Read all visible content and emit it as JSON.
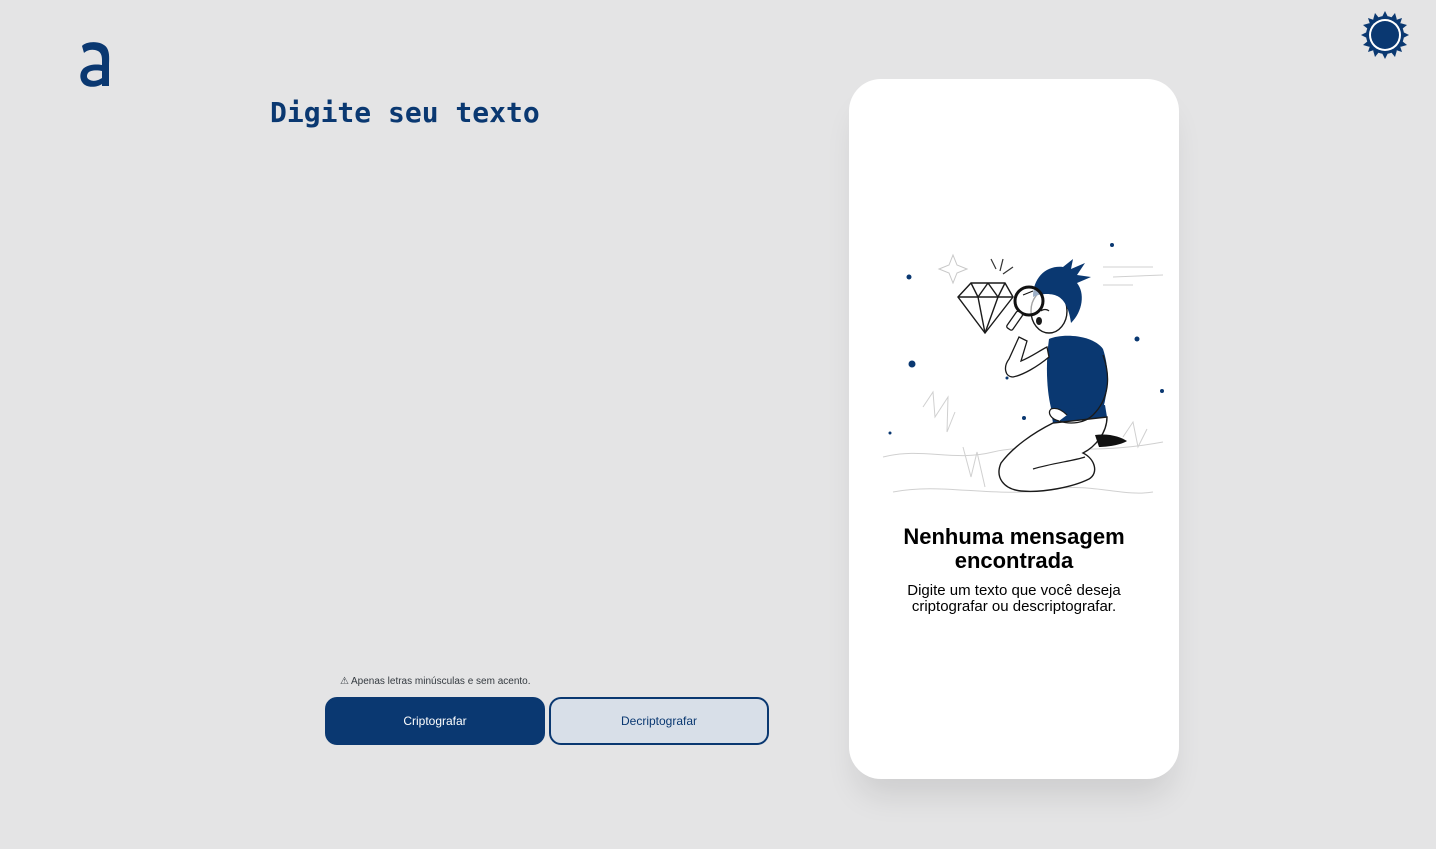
{
  "brand": {
    "logo_icon": "alura-logo-icon",
    "color": "#0a3871"
  },
  "theme_toggle": {
    "icon": "sun-icon"
  },
  "input": {
    "placeholder": "Digite seu texto",
    "value": ""
  },
  "hint": {
    "icon": "warning-icon",
    "symbol": "⚠",
    "text": "Apenas letras minúsculas e sem acento."
  },
  "actions": {
    "encrypt_label": "Criptografar",
    "decrypt_label": "Decriptografar"
  },
  "output": {
    "illustration": "person-with-magnifier-illustration",
    "title": "Nenhuma mensagem encontrada",
    "description": "Digite um texto que você deseja criptografar ou descriptografar."
  },
  "colors": {
    "background": "#e4e4e5",
    "accent": "#0a3871",
    "secondary_button": "#d8dfe8",
    "card": "#ffffff"
  }
}
